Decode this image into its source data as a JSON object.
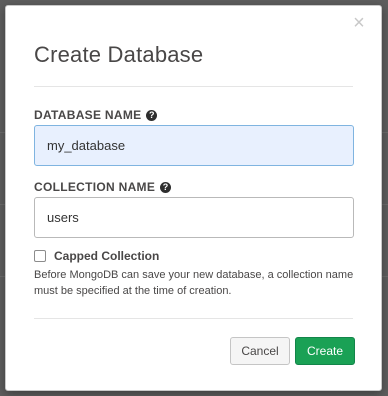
{
  "dialog": {
    "title": "Create Database",
    "close_glyph": "×",
    "help_glyph": "?",
    "database_name": {
      "label": "DATABASE NAME",
      "value": "my_database"
    },
    "collection_name": {
      "label": "COLLECTION NAME",
      "value": "users"
    },
    "capped_collection": {
      "label": "Capped Collection",
      "checked": false
    },
    "help_text": "Before MongoDB can save your new database, a collection name must be specified at the time of creation.",
    "buttons": {
      "cancel": "Cancel",
      "create": "Create"
    }
  },
  "colors": {
    "create_button": "#1aa155",
    "focused_input_bg": "#e8f0fe",
    "focused_input_border": "#7fb4e0"
  },
  "icons": {
    "close": "close-icon",
    "help": "question-circle-icon"
  }
}
